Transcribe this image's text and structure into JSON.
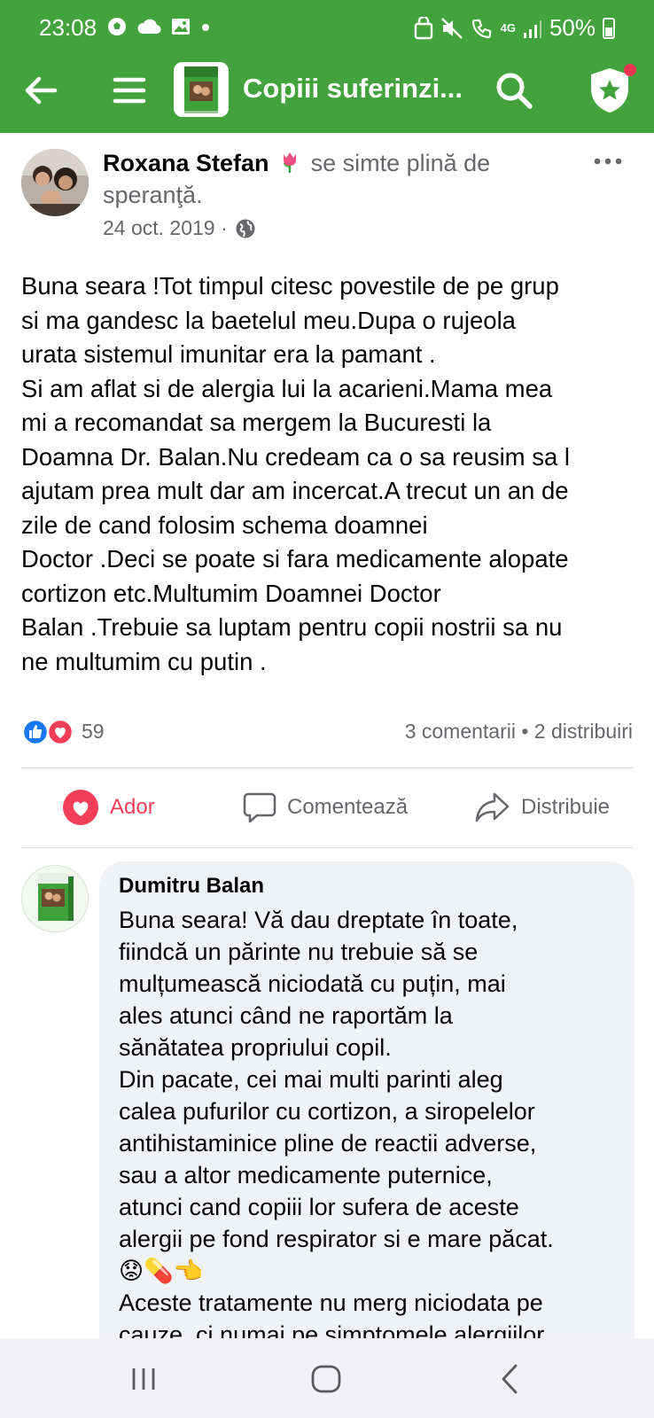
{
  "status_bar": {
    "time": "23:08",
    "battery": "50%",
    "network": "4G"
  },
  "nav": {
    "group_title": "Copiii suferinzi..."
  },
  "post": {
    "author": "Roxana Stefan",
    "feeling_text": "se simte plină de",
    "feeling_text_cont": "speranţă.",
    "date": "24 oct. 2019 ·",
    "text_lines": [
      "Buna seara !Tot timpul citesc povestile de pe grup",
      "si ma gandesc la baetelul meu.Dupa o rujeola",
      "urata sistemul imunitar era la pamant .",
      "Si am aflat si de alergia lui la acarieni.Mama mea",
      "mi a recomandat sa mergem la Bucuresti la",
      "Doamna Dr. Balan.Nu credeam ca o sa reusim sa l",
      "ajutam prea mult dar am incercat.A trecut un an de",
      "zile de cand folosim schema doamnei",
      "Doctor .Deci se poate si fara medicamente alopate",
      "cortizon etc.Multumim Doamnei Doctor",
      "Balan .Trebuie sa luptam pentru copii nostrii sa nu",
      "ne multumim cu putin ."
    ],
    "reaction_count": "59",
    "stats": "3 comentarii • 2 distribuiri"
  },
  "actions": {
    "love_label": "Ador",
    "comment_label": "Comentează",
    "share_label": "Distribuie"
  },
  "comment": {
    "author": "Dumitru Balan",
    "text_lines": [
      "Buna seara! Vă dau dreptate în toate,",
      "fiindcă un părinte nu trebuie să se",
      "mulțumească niciodată cu puțin, mai",
      "ales atunci când ne raportăm la",
      "sănătatea propriului copil.",
      "Din pacate, cei mai multi parinti aleg",
      "calea pufurilor cu cortizon, a siropelelor",
      "antihistaminice pline de reactii adverse,",
      "sau a altor medicamente puternice,",
      "atunci cand copiii lor sufera de aceste",
      "alergii pe fond respirator si e mare păcat.",
      "😟💊👈",
      "Aceste tratamente nu merg niciodata pe",
      "cauze, ci numai pe simptomele alergiilor"
    ]
  },
  "colors": {
    "brand_green": "#42a33c",
    "love_red": "#f33e58",
    "like_blue": "#1877f2"
  }
}
